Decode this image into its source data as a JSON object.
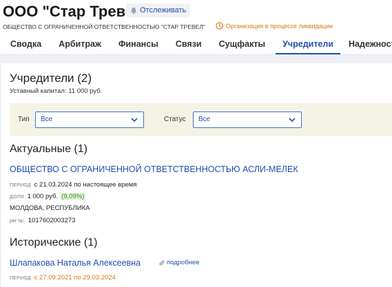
{
  "header": {
    "company_title": "ООО \"Стар Тревел\"",
    "follow_label": "Отслеживать",
    "full_name": "ОБЩЕСТВО С ОГРАНИЧЕННОЙ ОТВЕТСТВЕННОСТЬЮ \"СТАР ТРЕВЕЛ\"",
    "liquidation_status": "Организация в процессе ликвидации"
  },
  "tabs": [
    {
      "label": "Сводка"
    },
    {
      "label": "Арбитраж"
    },
    {
      "label": "Финансы"
    },
    {
      "label": "Связи"
    },
    {
      "label": "Сущфакты"
    },
    {
      "label": "Учредители",
      "active": true
    },
    {
      "label": "Надежность"
    }
  ],
  "founders": {
    "title": "Учредители (2)",
    "capital": "Уставный капитал: 11 000 руб.",
    "filters": {
      "type_label": "Тип",
      "type_value": "Все",
      "status_label": "Статус",
      "status_value": "Все"
    },
    "current": {
      "title": "Актуальные (1)",
      "items": [
        {
          "name": "ОБЩЕСТВО С ОГРАНИЧЕННОЙ ОТВЕТСТВЕННОСТЬЮ АСЛИ-МЕЛЕК",
          "period_key": "период",
          "period_value": "с 21.03.2024 по настоящее время",
          "share_key": "доля",
          "share_value": "1 000 руб.",
          "share_percent": "(9,09%)",
          "country": "МОЛДОВА, РЕСПУБЛИКА",
          "reg_key": "рег №:",
          "reg_value": "1017602003273"
        }
      ]
    },
    "historical": {
      "title": "Исторические (1)",
      "items": [
        {
          "name": "Шлапакова Наталья Алексеевна",
          "more_label": "подробнее",
          "period_key": "период",
          "period_value": "с 27.09.2021 по 29.03.2024"
        }
      ]
    }
  },
  "colors": {
    "accent": "#1f4fb0",
    "warning": "#d97a14",
    "share_green": "#2d8b2d",
    "filter_bg": "#f5f3e6"
  },
  "icons": {
    "follow": "bell-icon",
    "liquidation": "clock-warning-icon",
    "select": "chevron-down-icon",
    "more": "link-icon"
  }
}
